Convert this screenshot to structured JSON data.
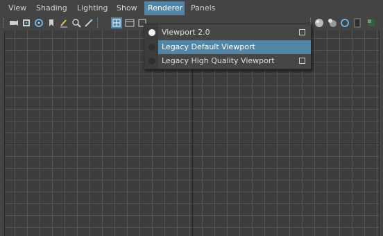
{
  "menubar": {
    "items": [
      {
        "label": "View"
      },
      {
        "label": "Shading"
      },
      {
        "label": "Lighting"
      },
      {
        "label": "Show"
      },
      {
        "label": "Renderer"
      },
      {
        "label": "Panels"
      }
    ],
    "active_index": 4,
    "active_color": "#5285a6"
  },
  "toolbar": {
    "icons_left": [
      "camera-icon",
      "camera-attributes-icon",
      "bookmark-icon",
      "image-plane-icon",
      "grease-pencil-icon",
      "2d-pan-zoom-icon",
      "grid-icon",
      "film-gate-icon",
      "resolution-gate-icon"
    ],
    "icons_right": [
      "shading-sphere-icon",
      "lighting-sphere-icon",
      "isolate-select-icon",
      "xray-icon",
      "textures-icon"
    ]
  },
  "renderer_menu": {
    "items": [
      {
        "label": "Viewport 2.0",
        "selected": true,
        "has_option_box": true
      },
      {
        "label": "Legacy Default Viewport",
        "selected": false,
        "has_option_box": false,
        "highlighted": true
      },
      {
        "label": "Legacy High Quality Viewport",
        "selected": false,
        "has_option_box": true
      }
    ]
  },
  "colors": {
    "background": "#444444",
    "grid_line": "#555555",
    "grid_axis": "#222222",
    "highlight": "#5285a6"
  }
}
